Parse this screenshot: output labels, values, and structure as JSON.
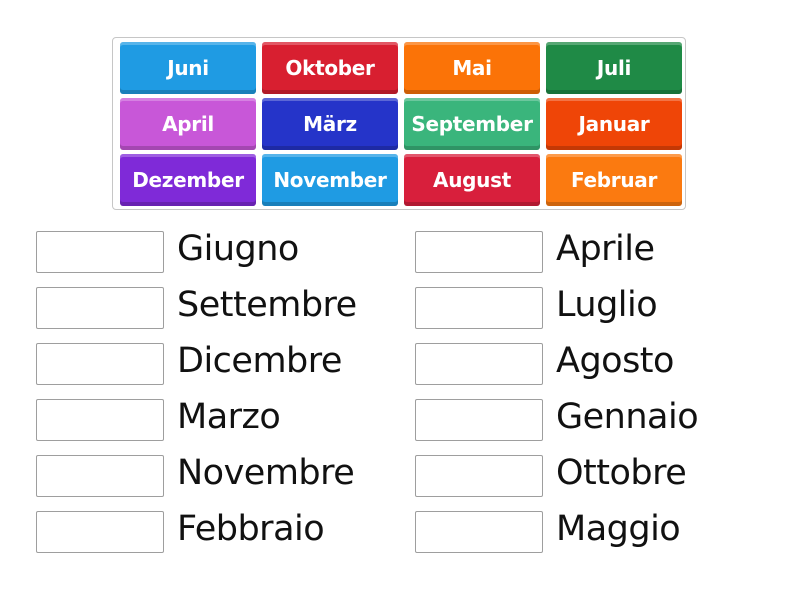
{
  "tiles": [
    {
      "label": "Juni",
      "color": "#1f9be3"
    },
    {
      "label": "Oktober",
      "color": "#d81f30"
    },
    {
      "label": "Mai",
      "color": "#fb7307"
    },
    {
      "label": "Juli",
      "color": "#1f8a46"
    },
    {
      "label": "April",
      "color": "#c857d8"
    },
    {
      "label": "März",
      "color": "#2534c9"
    },
    {
      "label": "September",
      "color": "#3ab57c"
    },
    {
      "label": "Januar",
      "color": "#ef4507"
    },
    {
      "label": "Dezember",
      "color": "#7f2ad8"
    },
    {
      "label": "November",
      "color": "#1f9be3"
    },
    {
      "label": "August",
      "color": "#d81f3c"
    },
    {
      "label": "Februar",
      "color": "#fb7a10"
    }
  ],
  "targets_left": [
    "Giugno",
    "Settembre",
    "Dicembre",
    "Marzo",
    "Novembre",
    "Febbraio"
  ],
  "targets_right": [
    "Aprile",
    "Luglio",
    "Agosto",
    "Gennaio",
    "Ottobre",
    "Maggio"
  ]
}
